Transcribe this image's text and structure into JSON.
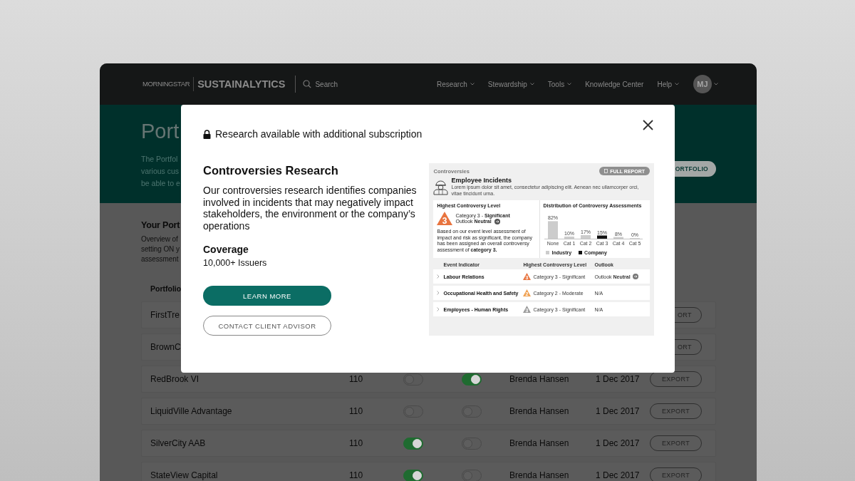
{
  "header": {
    "logo": "MORNINGSTAR",
    "brand": "SUSTAINALYTICS",
    "search": {
      "placeholder": "Search"
    },
    "nav": [
      {
        "label": "Research",
        "dropdown": true
      },
      {
        "label": "Stewardship",
        "dropdown": true
      },
      {
        "label": "Tools",
        "dropdown": true
      },
      {
        "label": "Knowledge Center",
        "dropdown": false
      },
      {
        "label": "Help",
        "dropdown": true
      }
    ],
    "avatar": "MJ"
  },
  "hero": {
    "title": "Port",
    "lines": [
      "The Portfol",
      "various cus",
      "be able to e"
    ],
    "button": "ORTFOLIO"
  },
  "section": {
    "title": "Your Port",
    "lines": [
      "Overview of",
      "setting ON y",
      "assessment"
    ],
    "column_1": "Portfolio"
  },
  "rows": [
    {
      "name": "FirstTre",
      "export": "ORT",
      "export_covered": true
    },
    {
      "name": "BrownC",
      "export": "ORT",
      "export_covered": true
    },
    {
      "name": "RedBrook VI",
      "count": "110",
      "switches": [
        {
          "on": false
        },
        {
          "on": true
        }
      ],
      "owner": "Brenda Hansen",
      "date": "1 Dec 2017",
      "export": "EXPORT",
      "export_covered": false
    },
    {
      "name": "LiquidVille Advantage",
      "count": "110",
      "switches": [
        {
          "on": false
        },
        {
          "on": false
        }
      ],
      "owner": "Brenda Hansen",
      "date": "1 Dec 2017",
      "export": "EXPORT",
      "export_covered": false
    },
    {
      "name": "SilverCity AAB",
      "count": "110",
      "switches": [
        {
          "on": true
        },
        {
          "on": false
        }
      ],
      "owner": "Brenda Hansen",
      "date": "1 Dec 2017",
      "export": "EXPORT",
      "export_covered": false
    },
    {
      "name": "StateView Capital",
      "count": "110",
      "switches": [
        {
          "on": true
        },
        {
          "on": false
        }
      ],
      "owner": "Brenda Hansen",
      "date": "1 Dec 2017",
      "export": "EXPORT",
      "export_covered": false
    }
  ],
  "modal": {
    "title": "Research available with additional subscription",
    "heading": "Controversies Research",
    "text": "Our controversies research identifies companies involved in incidents that may negatively impact stakeholders, the environment or the company’s operations",
    "coverage_title": "Coverage",
    "coverage": "10,000+ Issuers",
    "primary_button": "LEARN MORE",
    "secondary_button": "CONTACT CLIENT ADVISOR",
    "preview": {
      "section": "Controversies",
      "report_button": "FULL REPORT",
      "title": "Employee Incidents",
      "description": "Lorem ipsum dolor sit amet, consectetur adipiscing elit. Aenean nec ullamcorper orci, vitae tincidunt urna.",
      "level_title": "Highest Controversy Level",
      "level": {
        "badge": "3",
        "color": "#e8743f",
        "category": "Category 3 - **Significant**",
        "outlook": "Outlook **Neutral**"
      },
      "level_text": "Based on our event level assessment of impact and risk as significant, the company has been assigned an overall controversy assessment of **category 3.**",
      "chart_data": {
        "type": "bar",
        "title": "Distribution of Controversy Assessments",
        "categories": [
          "None",
          "Cat 1",
          "Cat 2",
          "Cat 3",
          "Cat 4",
          "Cat 5"
        ],
        "series": [
          {
            "name": "Industry",
            "color": "#cccccc",
            "values": [
              82,
              10,
              17,
              null,
              8,
              0
            ],
            "value_labels": [
              "82%",
              "10%",
              "17%",
              null,
              "8%",
              "0%"
            ]
          },
          {
            "name": "Company",
            "color": "#111111",
            "values": [
              null,
              null,
              null,
              15,
              null,
              null
            ],
            "value_labels": [
              null,
              null,
              null,
              "15%",
              null,
              null
            ]
          }
        ]
      },
      "columns": [
        "Event Indicator",
        "Highest Controversy Level",
        "Outlook"
      ],
      "events": [
        {
          "name": "Labour Relations",
          "badge": "3",
          "color": "#e8743f",
          "level": "Category 3 - Significant",
          "outlook": "Outlook **Neutral**",
          "outlook_icon": true
        },
        {
          "name": "Occupational Health and Safety",
          "badge": "2",
          "color": "#f0a050",
          "level": "Category 2 - Moderate",
          "outlook": "N/A",
          "outlook_icon": false
        },
        {
          "name": "Employees - Human Rights",
          "badge": "3",
          "color": "#9a9a9a",
          "level": "Category 3 - Significant",
          "outlook": "N/A",
          "outlook_icon": false
        }
      ]
    }
  }
}
